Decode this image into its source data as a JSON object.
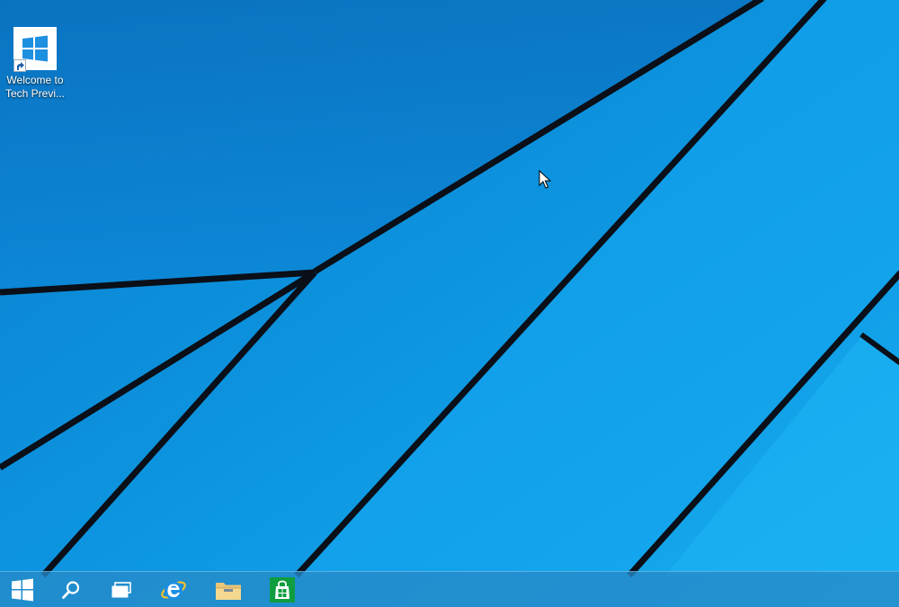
{
  "desktop": {
    "background_color": "#0a8fdc",
    "icons": [
      {
        "label_line1": "Welcome to",
        "label_line2": "Tech Previ...",
        "icon": "windows-logo-icon"
      }
    ]
  },
  "taskbar": {
    "background_color": "#268ac8",
    "buttons": [
      {
        "name": "start-button",
        "icon": "windows-logo-icon"
      },
      {
        "name": "search-button",
        "icon": "search-icon"
      },
      {
        "name": "task-view-button",
        "icon": "task-view-icon"
      },
      {
        "name": "internet-explorer-button",
        "icon": "internet-explorer-icon"
      },
      {
        "name": "file-explorer-button",
        "icon": "folder-icon"
      },
      {
        "name": "store-button",
        "icon": "store-icon"
      }
    ]
  },
  "cursor": {
    "icon": "arrow-cursor-icon"
  }
}
